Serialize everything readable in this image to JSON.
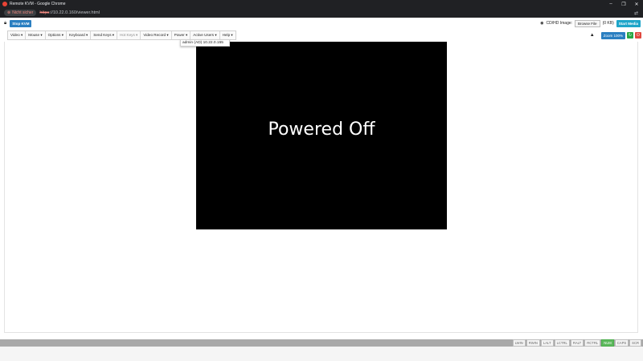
{
  "window": {
    "title": "Remote KVM - Google Chrome",
    "controls": [
      "–",
      "❐",
      "✕"
    ]
  },
  "address": {
    "security_label": "Nicht sicher",
    "url_scheme": "https",
    "url_rest": "://10.22.0.160/viewer.html"
  },
  "toolbar": {
    "stop_kvm": "Stop KVM",
    "cd_label": "CD/HD Image:",
    "browse_file": "Browse File",
    "file_size": "(0 KB)",
    "start_media": "Start Media"
  },
  "menus": [
    {
      "label": "Video ▾",
      "disabled": false
    },
    {
      "label": "Mouse ▾",
      "disabled": false
    },
    {
      "label": "Options ▾",
      "disabled": false
    },
    {
      "label": "Keyboard ▾",
      "disabled": false
    },
    {
      "label": "Send Keys ▾",
      "disabled": false
    },
    {
      "label": "Hot Keys ▾",
      "disabled": true
    },
    {
      "label": "Video Record ▾",
      "disabled": false
    },
    {
      "label": "Power ▾",
      "disabled": false
    },
    {
      "label": "Active Users ▾",
      "disabled": false
    },
    {
      "label": "Help ▾",
      "disabled": false
    }
  ],
  "zoom_label": "Zoom 100%",
  "active_users": {
    "entry": "admin (AD) 10.22.0.155"
  },
  "screen": {
    "message": "Powered Off"
  },
  "keys": [
    {
      "label": "LWIN",
      "active": false
    },
    {
      "label": "RWIN",
      "active": false
    },
    {
      "label": "LALT",
      "active": false
    },
    {
      "label": "LCTRL",
      "active": false
    },
    {
      "label": "RALT",
      "active": false
    },
    {
      "label": "RCTRL",
      "active": false
    },
    {
      "label": "NUM",
      "active": true
    },
    {
      "label": "CAPS",
      "active": false
    },
    {
      "label": "SCR",
      "active": false
    }
  ],
  "colors": {
    "accent_blue": "#2a7fc1",
    "teal": "#1ea5c9",
    "num_active": "#5cb85c"
  }
}
